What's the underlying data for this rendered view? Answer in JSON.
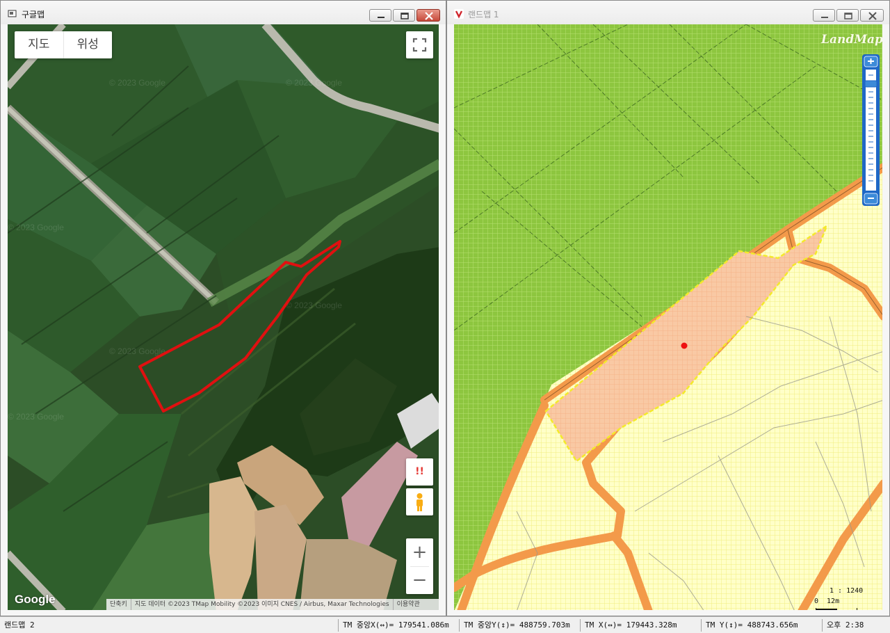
{
  "google_window": {
    "title": "구글맵",
    "map_type_map": "지도",
    "map_type_satellite": "위성",
    "issue_label": "!!",
    "zoom_in": "+",
    "zoom_out": "−",
    "logo": "Google",
    "watermark": "© 2023 Google",
    "attribution": [
      "단축키",
      "지도 데이터 ©2023 TMap Mobility ©2023 이미지 CNES / Airbus, Maxar Technologies",
      "이용약관"
    ]
  },
  "landmap_window": {
    "title": "랜드맵 1",
    "logo": "LandMap",
    "scale_ratio": "1 : 1240",
    "scale_zero": "0",
    "scale_length": "12m"
  },
  "status_bar": {
    "left_label": "랜드맵 2",
    "tm_center_x": "TM 중앙X(↔)= 179541.086m",
    "tm_center_y": "TM 중앙Y(↕)= 488759.703m",
    "tm_x": "TM X(↔)= 179443.328m",
    "tm_y": "TM Y(↕)= 488743.656m",
    "clock": "오후 2:38"
  },
  "colors": {
    "parcel_outline": "#e01010",
    "farmland_green": "#8dc63f",
    "road_orange": "#f39a4a",
    "selected_parcel": "#f9c9a4",
    "grid_yellow": "#ffff9a",
    "zoom_blue": "#1f68c6"
  }
}
